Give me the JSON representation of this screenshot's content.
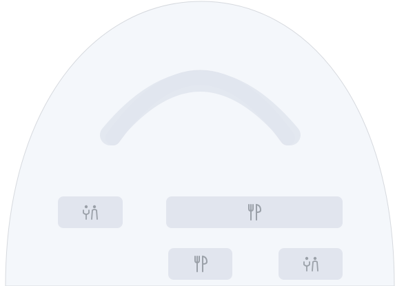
{
  "colors": {
    "venue_fill": "#f4f7fb",
    "venue_stroke": "#d6d9de",
    "stage_fill": "#e1e5ee",
    "zone_fill": "#e1e5ee",
    "icon_color": "#9aa0a8",
    "background": "#ffffff"
  },
  "zones": [
    {
      "id": "restroom-left",
      "icon": "restroom-icon"
    },
    {
      "id": "dining-wide",
      "icon": "dining-icon"
    },
    {
      "id": "dining-small",
      "icon": "dining-icon"
    },
    {
      "id": "restroom-right",
      "icon": "restroom-icon"
    }
  ]
}
